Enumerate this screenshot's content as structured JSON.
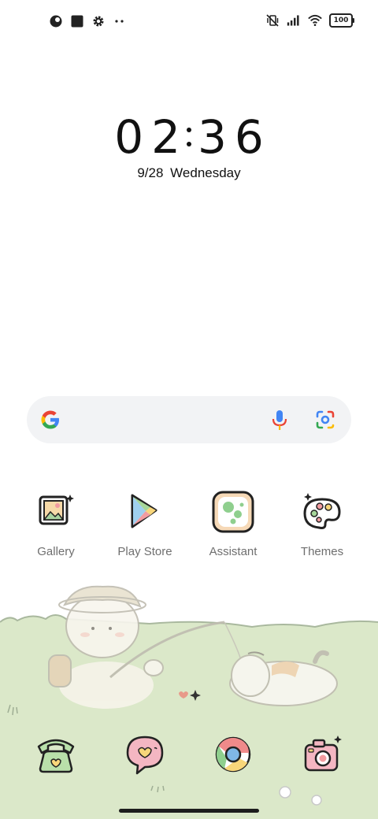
{
  "status_bar": {
    "left_icons": [
      "theme-circle-icon",
      "square-icon",
      "settings-gear-icon",
      "more-dots-icon"
    ],
    "right_icons": [
      "vibrate-off-icon",
      "signal-icon",
      "wifi-icon",
      "battery-icon"
    ],
    "battery_level": "100"
  },
  "clock": {
    "hour_tens": "0",
    "hour_ones": "2",
    "minute_tens": "3",
    "minute_ones": "6",
    "date": "9/28",
    "weekday": "Wednesday"
  },
  "search_bar": {
    "icons": [
      "google-g-icon",
      "microphone-icon",
      "google-lens-icon"
    ]
  },
  "apps": [
    {
      "label": "Gallery",
      "icon": "gallery-icon"
    },
    {
      "label": "Play Store",
      "icon": "play-store-icon"
    },
    {
      "label": "Assistant",
      "icon": "assistant-icon"
    },
    {
      "label": "Themes",
      "icon": "themes-icon"
    }
  ],
  "dock": [
    {
      "icon": "phone-icon"
    },
    {
      "icon": "messages-icon"
    },
    {
      "icon": "chrome-icon"
    },
    {
      "icon": "camera-icon"
    }
  ],
  "colors": {
    "grass": "#dbe8c9",
    "grass_line": "#a9b89e",
    "label": "#6f6f6f"
  }
}
